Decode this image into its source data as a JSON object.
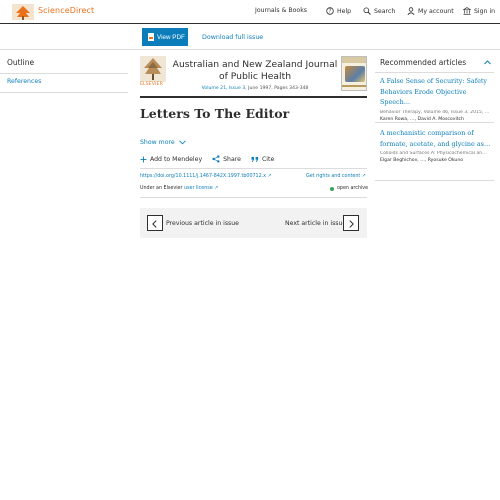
{
  "header": {
    "brand": "ScienceDirect",
    "nav": {
      "journals_books": "Journals & Books",
      "help": "Help",
      "search": "Search",
      "my_account": "My account",
      "sign_in": "Sign in"
    }
  },
  "toolbar": {
    "view_pdf": "View PDF",
    "download_issue": "Download full issue"
  },
  "outline": {
    "title": "Outline",
    "items": [
      "References"
    ]
  },
  "journal": {
    "publisher_logo_text": "ELSEVIER",
    "title": "Australian and New Zealand Journal of Public Health",
    "meta_prefix": "Volume 21, Issue 3,",
    "meta_suffix": " June 1997, Pages 343-348"
  },
  "article": {
    "title": "Letters To The Editor",
    "show_more": "Show more",
    "actions": {
      "add_mendeley": "Add to Mendeley",
      "share": "Share",
      "cite": "Cite"
    },
    "doi": "https://doi.org/10.1111/j.1467-842X.1997.tb00712.x ↗",
    "rights": "Get rights and content ↗",
    "license_prefix": "Under an Elsevier ",
    "license_link": "user license ↗",
    "open_archive": "open archive"
  },
  "issue_nav": {
    "previous": "Previous article in issue",
    "next": "Next article in issue"
  },
  "recommended": {
    "title": "Recommended articles",
    "items": [
      {
        "title": "A False Sense of Security: Safety Behaviors Erode Objective Speech…",
        "source": "Behavior Therapy, Volume 46, Issue 3, 2015, …",
        "authors": "Karen Rowa, …, David A. Moscovitch"
      },
      {
        "title": "A mechanistic comparison of formate, acetate, and glycine as…",
        "source": "Colloids and Surfaces A: Physicochemical an…",
        "authors": "Elgar Beghichov, …, Ryosuke Okuno"
      }
    ]
  },
  "colors": {
    "accent": "#0c7dbb",
    "brand": "#e9711c",
    "open_access": "#3aa35a"
  }
}
